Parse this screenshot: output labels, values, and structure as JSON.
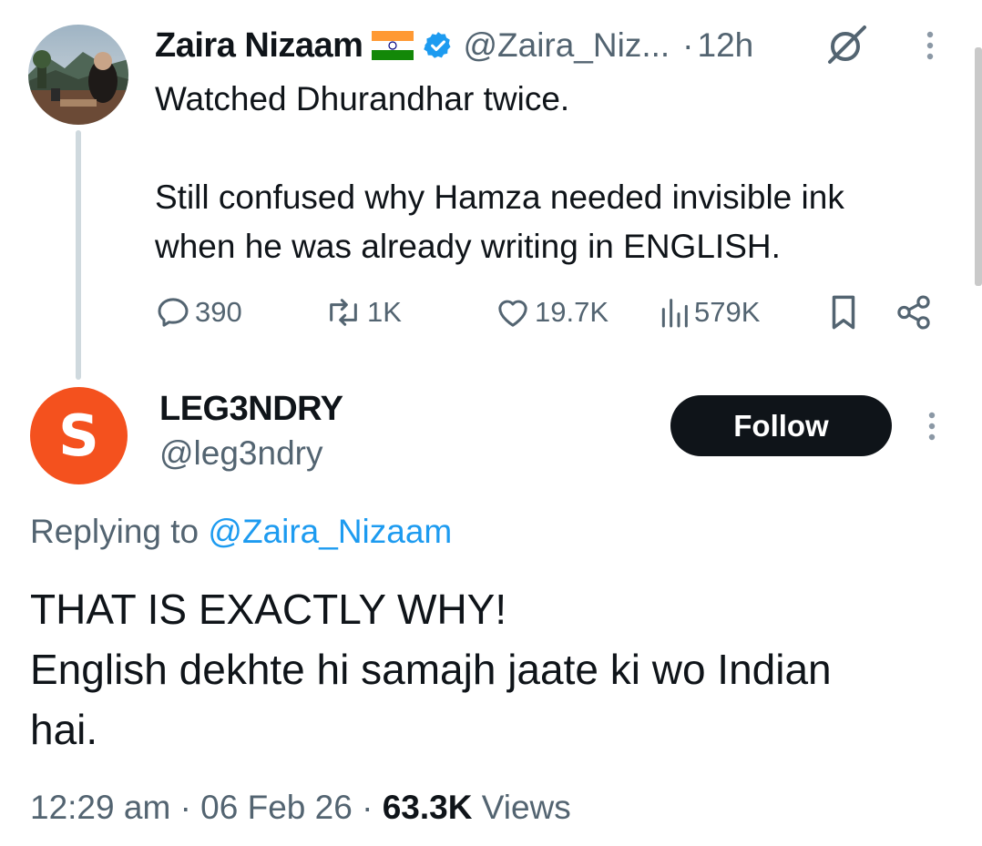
{
  "parent_tweet": {
    "author_name": "Zaira Nizaam",
    "handle": "@Zaira_Niz...",
    "separator": "·",
    "time": "12h",
    "flag_icon": "india-flag-icon",
    "verified_icon": "verified-badge-icon",
    "grok_icon": "grok-icon",
    "text_line1": "Watched Dhurandhar twice.",
    "text_line2": "Still confused why Hamza needed invisible ink",
    "text_line3": "when he was already writing in ENGLISH.",
    "actions": {
      "replies": "390",
      "reposts": "1K",
      "likes": "19.7K",
      "views": "579K"
    }
  },
  "reply_tweet": {
    "author_name": "LEG3NDRY",
    "handle": "@leg3ndry",
    "avatar_letter": "S",
    "avatar_color": "#f4511e",
    "follow_label": "Follow",
    "replying_prefix": "Replying to",
    "replying_to": "@Zaira_Nizaam",
    "text_line1": "THAT IS EXACTLY WHY!",
    "text_line2": "English dekhte hi samajh jaate ki wo Indian",
    "text_line3": "hai.",
    "time": "12:29 am",
    "dot1": "·",
    "date": "06 Feb 26",
    "dot2": "·",
    "views_count": "63.3K",
    "views_label": "Views"
  },
  "colors": {
    "text": "#0f1419",
    "secondary": "#536471",
    "link": "#1d9bf0",
    "thread_line": "#cfd9de"
  }
}
